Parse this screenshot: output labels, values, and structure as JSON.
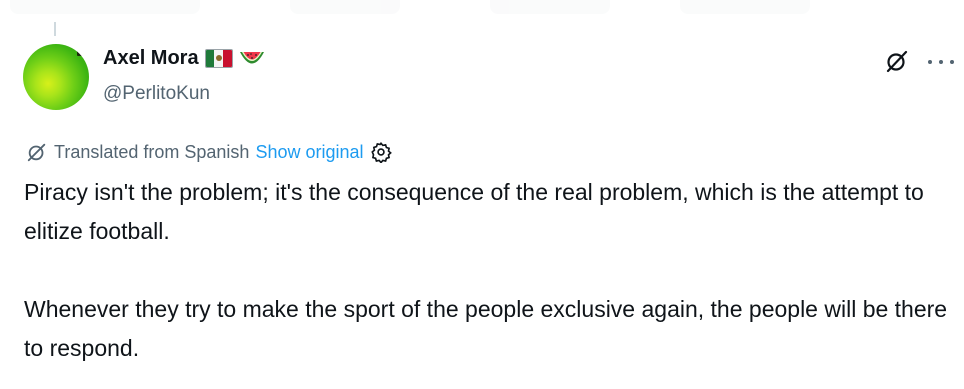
{
  "author": {
    "display_name": "Axel Mora",
    "handle": "@PerlitoKun",
    "emojis": [
      "mexico-flag-emoji",
      "watermelon-emoji"
    ]
  },
  "translation": {
    "label": "Translated from Spanish",
    "show_original": "Show original"
  },
  "tweet": {
    "paragraphs": [
      "Piracy isn't the problem; it's the consequence of the real problem, which is the attempt to elitize football.",
      "Whenever they try to make the sport of the people exclusive again, the people will be there to respond."
    ]
  },
  "colors": {
    "text": "#0f1419",
    "secondary": "#536471",
    "link": "#1d9bf0"
  }
}
